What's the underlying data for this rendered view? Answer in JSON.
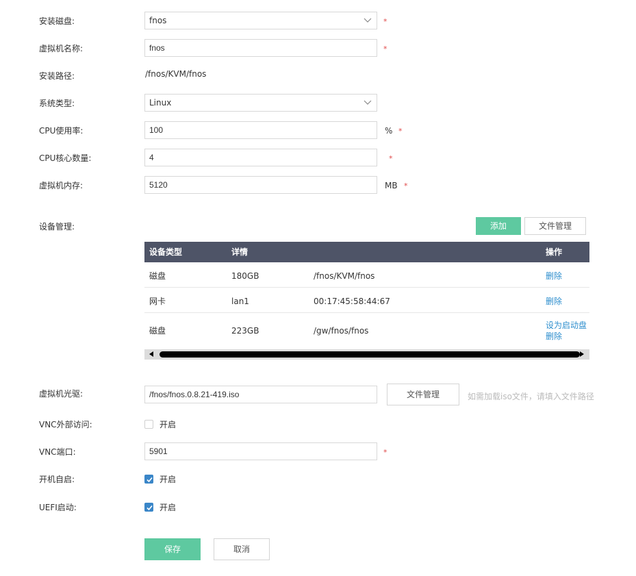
{
  "form": {
    "install_disk": {
      "label": "安装磁盘:",
      "value": "fnos",
      "required": "*"
    },
    "vm_name": {
      "label": "虚拟机名称:",
      "value": "fnos",
      "required": "*"
    },
    "install_path": {
      "label": "安装路径:",
      "value": "/fnos/KVM/fnos"
    },
    "os_type": {
      "label": "系统类型:",
      "value": "Linux"
    },
    "cpu_usage": {
      "label": "CPU使用率:",
      "value": "100",
      "unit": "%",
      "required": "*"
    },
    "cpu_cores": {
      "label": "CPU核心数量:",
      "value": "4",
      "required": "*"
    },
    "memory": {
      "label": "虚拟机内存:",
      "value": "5120",
      "unit": "MB",
      "required": "*"
    }
  },
  "devices": {
    "label": "设备管理:",
    "add_button": "添加",
    "file_manager_button": "文件管理",
    "columns": [
      "设备类型",
      "详情",
      "",
      "操作"
    ],
    "rows": [
      {
        "type": "磁盘",
        "size": "180GB",
        "detail": "/fnos/KVM/fnos",
        "actions": [
          "删除"
        ]
      },
      {
        "type": "网卡",
        "size": "lan1",
        "detail": "00:17:45:58:44:67",
        "actions": [
          "删除"
        ]
      },
      {
        "type": "磁盘",
        "size": "223GB",
        "detail": "/gw/fnos/fnos",
        "actions": [
          "设为启动盘",
          "删除"
        ]
      }
    ]
  },
  "cdrom": {
    "label": "虚拟机光驱:",
    "value": "/fnos/fnos.0.8.21-419.iso",
    "file_manager_button": "文件管理",
    "hint": "如需加载iso文件，请填入文件路径"
  },
  "vnc_external": {
    "label": "VNC外部访问:",
    "option": "开启",
    "checked": false
  },
  "vnc_port": {
    "label": "VNC端口:",
    "value": "5901",
    "required": "*"
  },
  "autostart": {
    "label": "开机自启:",
    "option": "开启",
    "checked": true
  },
  "uefi": {
    "label": "UEFI启动:",
    "option": "开启",
    "checked": true
  },
  "actions": {
    "save": "保存",
    "cancel": "取消"
  },
  "colors": {
    "accent_green": "#5ec9a0",
    "table_header": "#4e5467",
    "link": "#2f8fce",
    "required": "#e04a4a",
    "checkbox": "#3a86c8"
  }
}
